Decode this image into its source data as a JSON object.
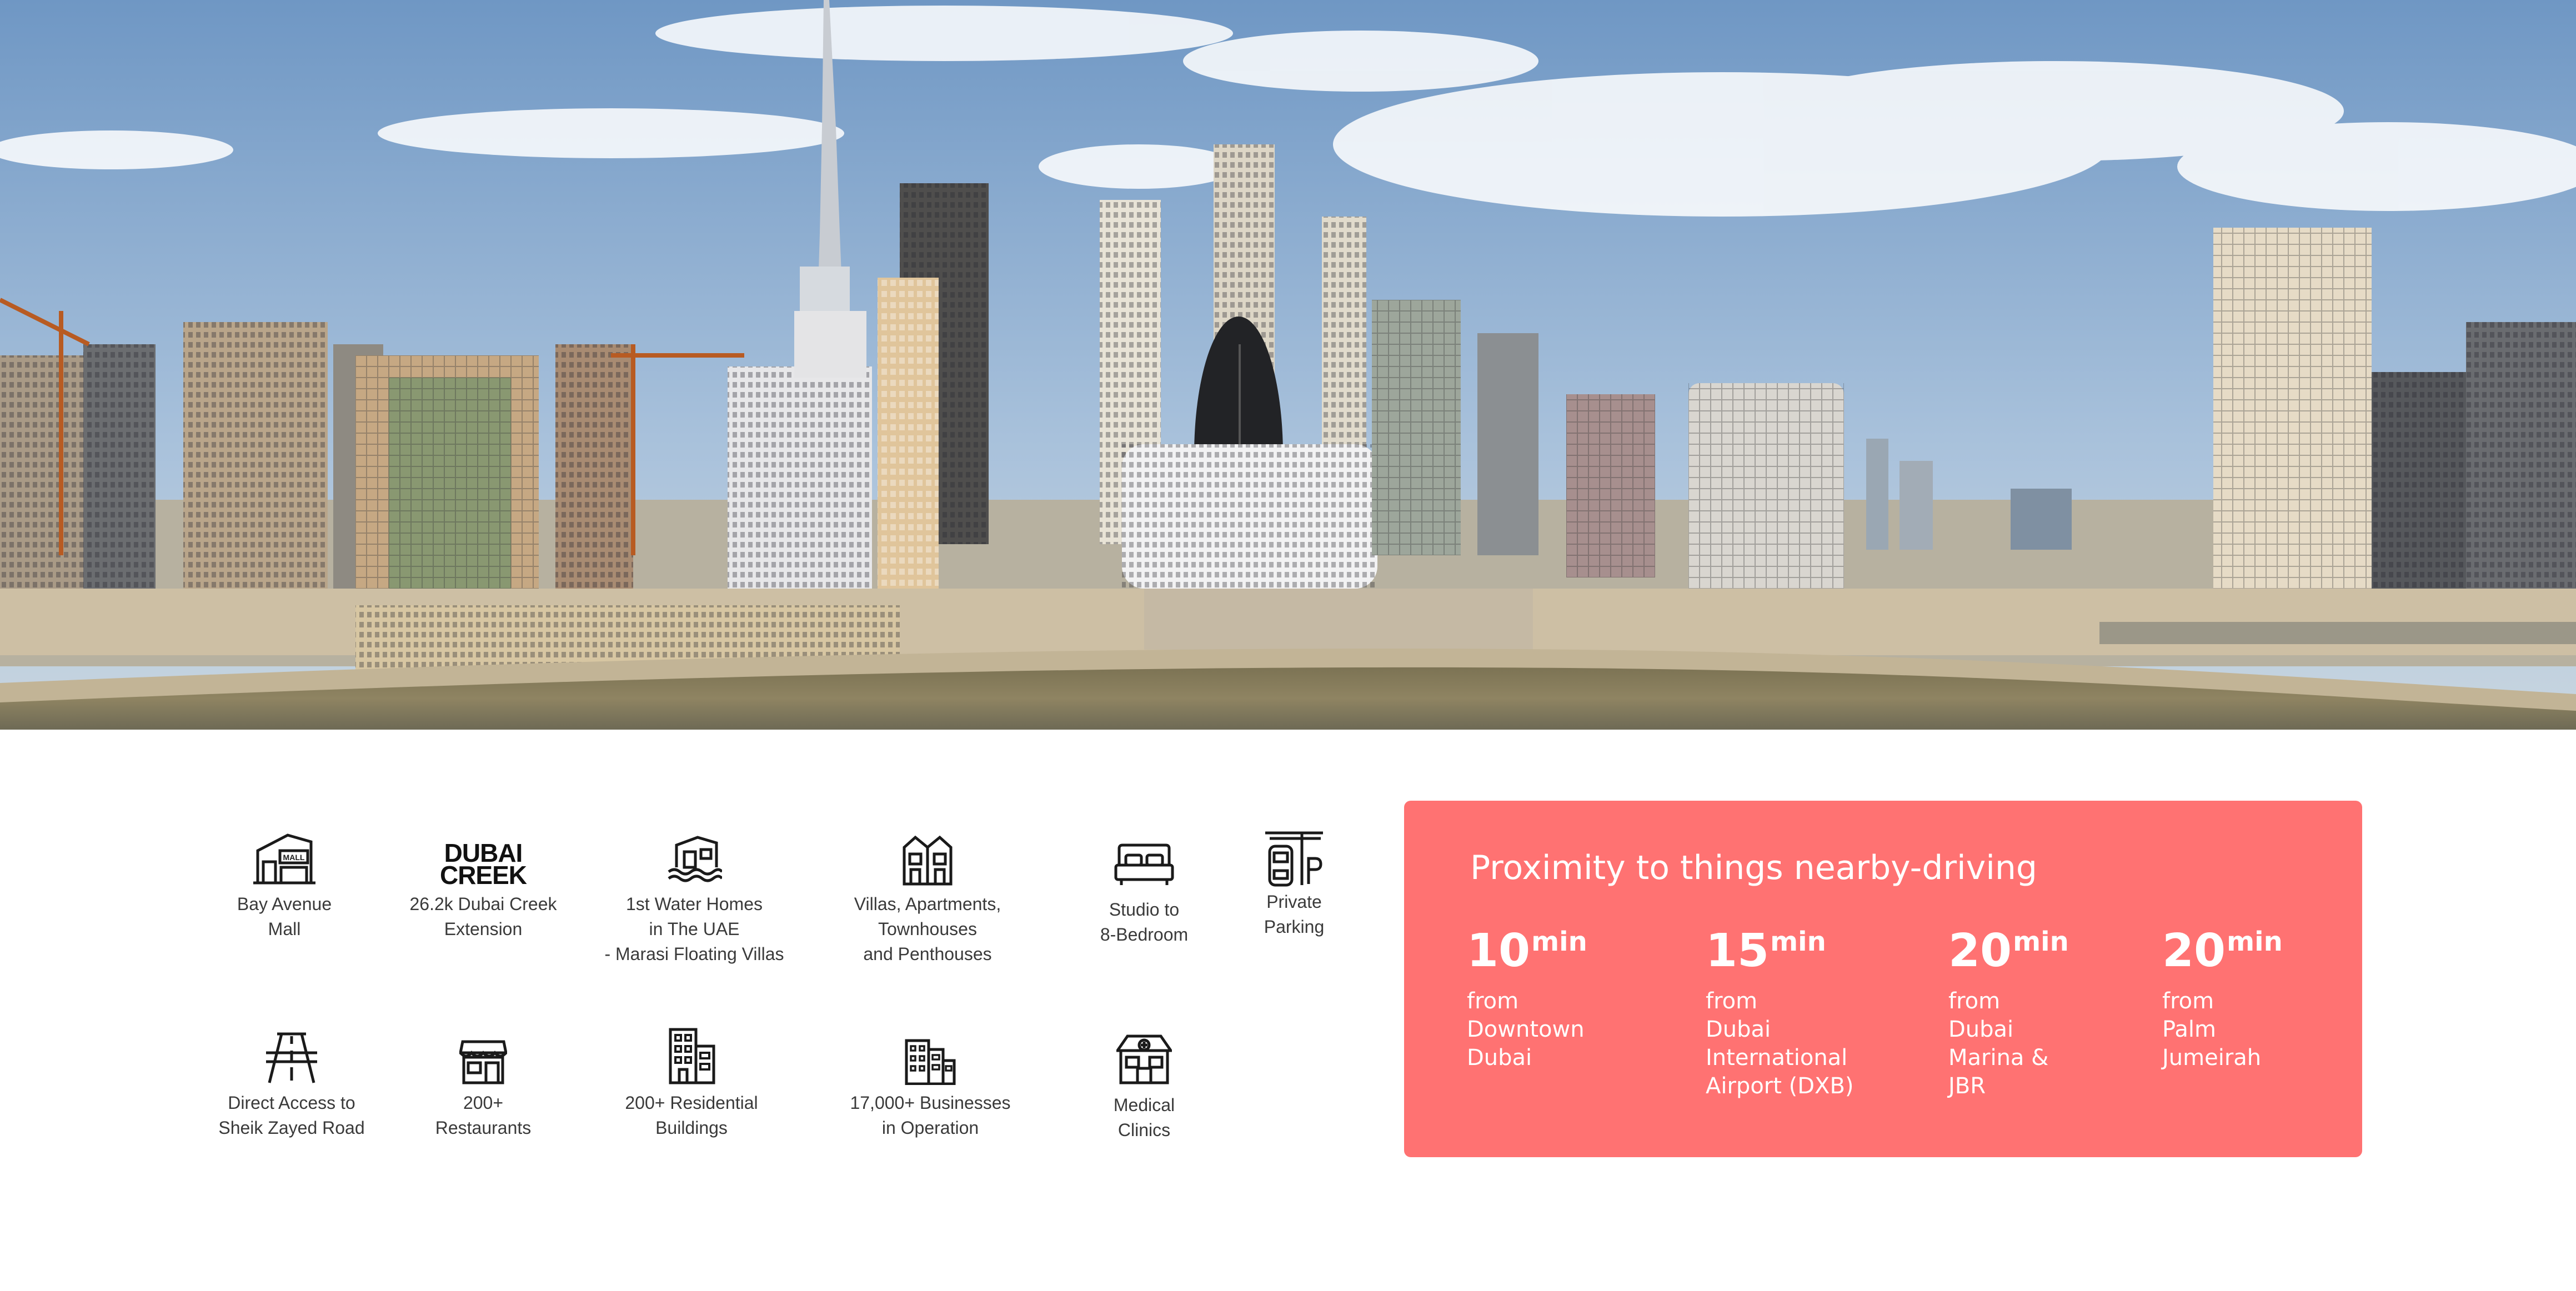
{
  "amenities": [
    {
      "id": "mall",
      "icon": "mall-icon",
      "lines": [
        "Bay Avenue",
        "Mall"
      ]
    },
    {
      "id": "creek",
      "icon": "dubai-creek-logo",
      "logo": [
        "DUBAI",
        "CREEK"
      ],
      "lines": [
        "26.2k Dubai Creek",
        "Extension"
      ]
    },
    {
      "id": "water",
      "icon": "water-home-icon",
      "lines": [
        "1st Water Homes",
        "in The UAE",
        "- Marasi Floating Villas"
      ]
    },
    {
      "id": "villas",
      "icon": "townhouse-icon",
      "lines": [
        "Villas, Apartments,",
        "Townhouses",
        "and Penthouses"
      ]
    },
    {
      "id": "bedroom",
      "icon": "bed-icon",
      "lines": [
        "Studio to",
        "8-Bedroom"
      ]
    },
    {
      "id": "parking",
      "icon": "parking-icon",
      "lines": [
        "Private",
        "Parking"
      ]
    },
    {
      "id": "road",
      "icon": "road-icon",
      "lines": [
        "Direct Access to",
        "Sheik Zayed Road"
      ]
    },
    {
      "id": "restaurants",
      "icon": "restaurant-icon",
      "lines": [
        "200+",
        "Restaurants"
      ]
    },
    {
      "id": "residential",
      "icon": "building-icon",
      "lines": [
        "200+ Residential",
        "Buildings"
      ]
    },
    {
      "id": "businesses",
      "icon": "business-icon",
      "lines": [
        "17,000+ Businesses",
        "in Operation"
      ]
    },
    {
      "id": "clinics",
      "icon": "clinic-icon",
      "lines": [
        "Medical",
        "Clinics"
      ]
    }
  ],
  "proximity": {
    "title": "Proximity to things nearby-driving",
    "unit": "min",
    "items": [
      {
        "value": "10",
        "lines": [
          "from",
          "Downtown",
          "Dubai"
        ]
      },
      {
        "value": "15",
        "lines": [
          "from",
          "Dubai",
          "International",
          "Airport (DXB)"
        ]
      },
      {
        "value": "20",
        "lines": [
          "from",
          "Dubai",
          "Marina &",
          "JBR"
        ]
      },
      {
        "value": "20",
        "lines": [
          "from",
          "Palm",
          "Jumeirah"
        ]
      }
    ]
  },
  "colors": {
    "card": "#ff7272",
    "sky_top": "#6f97c4",
    "sky_bottom": "#b9cde0",
    "water": "#8a7e5c",
    "icon": "#1a1a1a"
  }
}
